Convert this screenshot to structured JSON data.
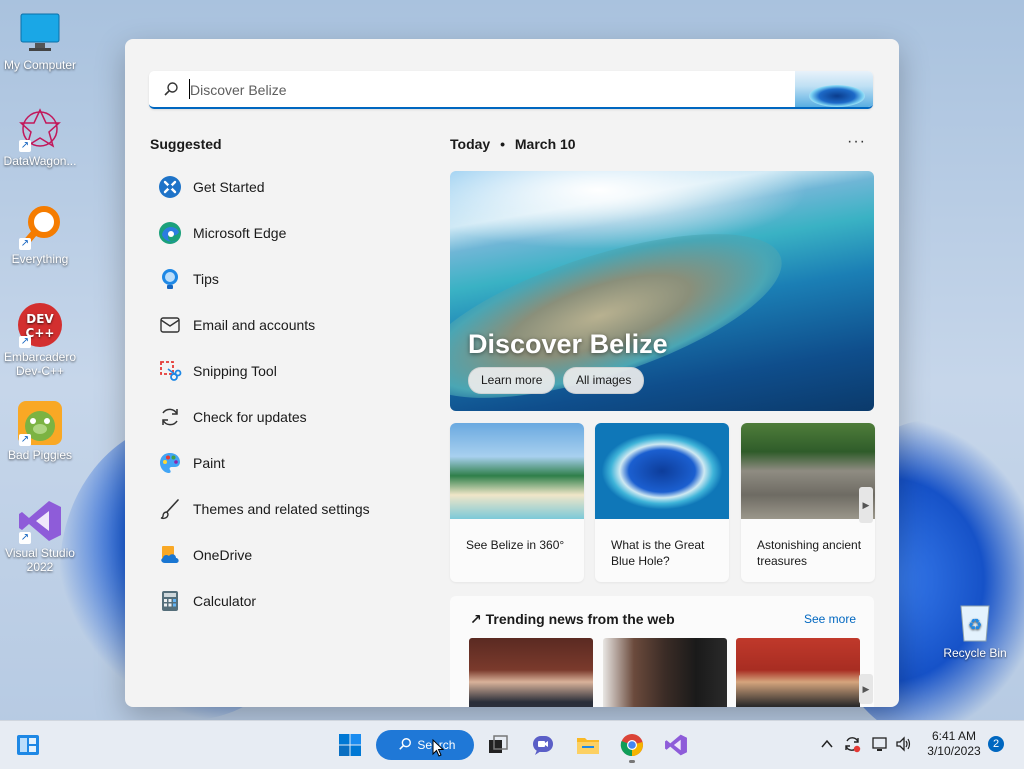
{
  "desktop": {
    "icons": [
      {
        "label": "My Computer"
      },
      {
        "label": "DataWagon..."
      },
      {
        "label": "Everything"
      },
      {
        "label": "Embarcadero Dev-C++"
      },
      {
        "label": "Bad Piggies"
      },
      {
        "label": "Visual Studio 2022"
      }
    ],
    "recycle_bin": {
      "label": "Recycle Bin"
    }
  },
  "start": {
    "search": {
      "value": "",
      "placeholder": "Discover Belize"
    },
    "suggested": {
      "title": "Suggested",
      "items": [
        {
          "label": "Get Started",
          "icon": "get-started-icon"
        },
        {
          "label": "Microsoft Edge",
          "icon": "edge-icon"
        },
        {
          "label": "Tips",
          "icon": "tips-icon"
        },
        {
          "label": "Email and accounts",
          "icon": "mail-icon"
        },
        {
          "label": "Snipping Tool",
          "icon": "snipping-tool-icon"
        },
        {
          "label": "Check for updates",
          "icon": "refresh-icon"
        },
        {
          "label": "Paint",
          "icon": "paint-icon"
        },
        {
          "label": "Themes and related settings",
          "icon": "brush-icon"
        },
        {
          "label": "OneDrive",
          "icon": "onedrive-icon"
        },
        {
          "label": "Calculator",
          "icon": "calculator-icon"
        }
      ]
    },
    "today": {
      "label": "Today",
      "separator": "•",
      "date": "March 10",
      "menu": "···"
    },
    "hero": {
      "title": "Discover Belize",
      "learn_more": "Learn more",
      "all_images": "All images"
    },
    "cards": [
      {
        "caption": "See Belize in 360°"
      },
      {
        "caption": "What is the Great Blue Hole?"
      },
      {
        "caption": "Astonishing ancient treasures"
      }
    ],
    "trending": {
      "title": "Trending news from the web",
      "see_more": "See more"
    }
  },
  "taskbar": {
    "search_label": "Search",
    "time": "6:41 AM",
    "date": "3/10/2023",
    "notification_count": "2"
  },
  "colors": {
    "accent": "#0067c0",
    "search_button": "#1f78d7",
    "panel_bg": "#f3f3f3"
  }
}
